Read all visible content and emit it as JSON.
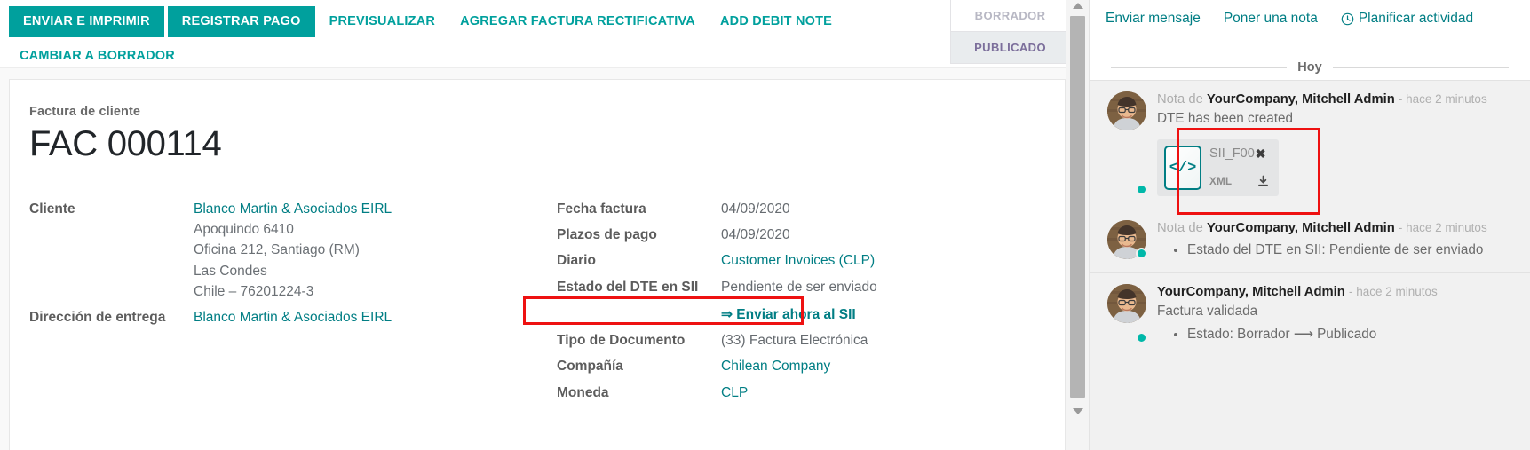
{
  "control_panel": {
    "buttons": [
      {
        "label": "ENVIAR E IMPRIMIR",
        "style": "primary",
        "name": "send-and-print-button"
      },
      {
        "label": "REGISTRAR PAGO",
        "style": "secondary",
        "name": "register-payment-button"
      },
      {
        "label": "PREVISUALIZAR",
        "style": "link",
        "name": "preview-button"
      },
      {
        "label": "AGREGAR FACTURA RECTIFICATIVA",
        "style": "link",
        "name": "add-credit-note-button"
      },
      {
        "label": "ADD DEBIT NOTE",
        "style": "link",
        "name": "add-debit-note-button"
      }
    ],
    "buttons_row2": [
      {
        "label": "CAMBIAR A BORRADOR",
        "style": "link",
        "name": "reset-to-draft-button"
      }
    ],
    "statusbar": {
      "draft_label": "BORRADOR",
      "posted_label": "PUBLICADO",
      "active": "PUBLICADO"
    }
  },
  "sheet": {
    "title_label": "Factura de cliente",
    "title": "FAC 000114",
    "left_fields": [
      {
        "label": "Cliente",
        "value": "Blanco Martin & Asociados EIRL",
        "is_link": true,
        "extra_lines": [
          "Apoquindo 6410",
          "Oficina 212, Santiago (RM)",
          "Las Condes",
          "Chile – 76201224-3"
        ]
      },
      {
        "label": "Dirección de entrega",
        "value": "Blanco Martin & Asociados EIRL",
        "is_link": true,
        "extra_lines": []
      }
    ],
    "right_fields": [
      {
        "label": "Fecha factura",
        "value": "04/09/2020",
        "is_link": false
      },
      {
        "label": "Plazos de pago",
        "value": "04/09/2020",
        "is_link": false
      },
      {
        "label": "Diario",
        "value": "Customer Invoices (CLP)",
        "is_link": true
      },
      {
        "label": "Estado del DTE en SII",
        "value": "Pendiente de ser enviado",
        "is_link": false
      },
      {
        "label": "",
        "value": "⇒ Enviar ahora al SII",
        "is_link": true,
        "is_action": true
      },
      {
        "label": "Tipo de Documento",
        "value": "(33) Factura Electrónica",
        "is_link": false
      },
      {
        "label": "Compañía",
        "value": "Chilean Company",
        "is_link": true
      },
      {
        "label": "Moneda",
        "value": "CLP",
        "is_link": true
      }
    ]
  },
  "chatter": {
    "actions": [
      {
        "label": "Enviar mensaje",
        "name": "send-message-button",
        "icon": null
      },
      {
        "label": "Poner una nota",
        "name": "log-note-button",
        "icon": null
      },
      {
        "label": "Planificar actividad",
        "name": "schedule-activity-button",
        "icon": "clock-icon"
      }
    ],
    "date_separator": "Hoy",
    "messages": [
      {
        "prefix": "Nota de ",
        "author": "YourCompany, Mitchell Admin",
        "when": "- hace 2 minutos",
        "body": "DTE has been created",
        "tracking": [],
        "attachment": {
          "name": "SII_F00",
          "ext": "XML",
          "icon": "xml-file-icon",
          "close_label": "✖"
        }
      },
      {
        "prefix": "Nota de ",
        "author": "YourCompany, Mitchell Admin",
        "when": "- hace 2 minutos",
        "body": "",
        "tracking": [
          "Estado del DTE en SII: Pendiente de ser enviado"
        ],
        "attachment": null
      },
      {
        "prefix": "",
        "author": "YourCompany, Mitchell Admin",
        "when": "- hace 2 minutos",
        "body": "Factura validada",
        "tracking": [
          "Estado: Borrador ⟶ Publicado"
        ],
        "attachment": null
      }
    ]
  },
  "annotations": {
    "sii_highlight": "red-rectangle-sii-status",
    "attachment_highlight": "red-rectangle-attachment"
  },
  "colors": {
    "primary": "#00a09d",
    "link": "#017e84",
    "highlight": "#ee1111",
    "status_active": "#7c6f9b",
    "status_inactive": "#b8b8c4"
  }
}
